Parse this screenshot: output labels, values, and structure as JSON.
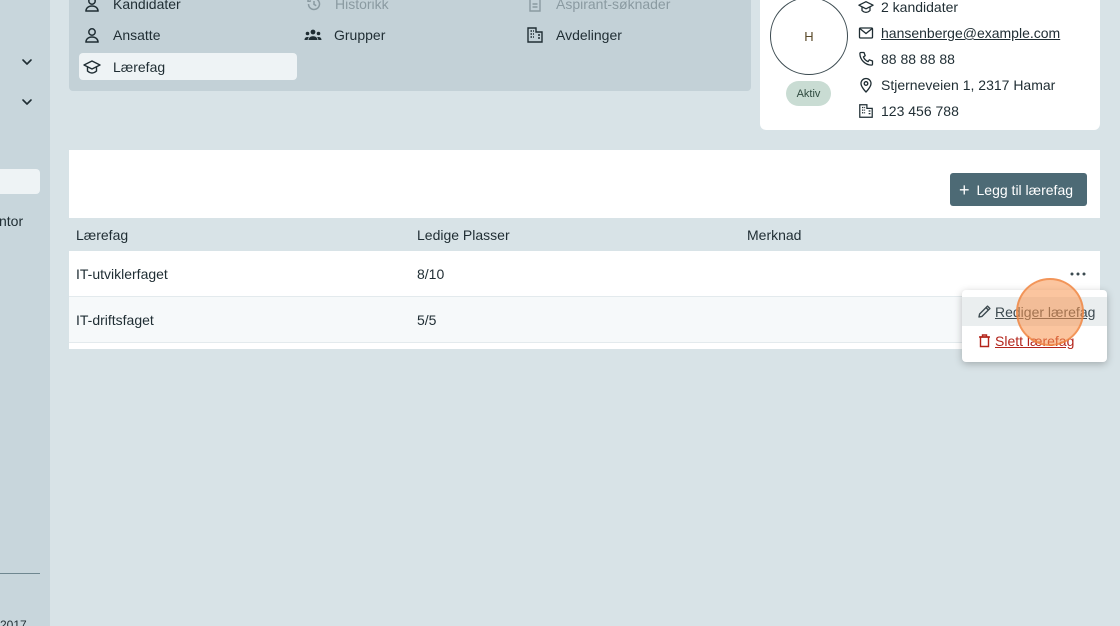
{
  "sidebar": {
    "partial_text": "ntor",
    "bottom_text": "2017"
  },
  "nav": {
    "items": [
      {
        "label": "Kandidater",
        "icon": "user-icon",
        "state": "normal"
      },
      {
        "label": "Historikk",
        "icon": "history-icon",
        "state": "disabled"
      },
      {
        "label": "Aspirant-søknader",
        "icon": "document-icon",
        "state": "disabled"
      },
      {
        "label": "Ansatte",
        "icon": "user-icon",
        "state": "normal"
      },
      {
        "label": "Grupper",
        "icon": "groups-icon",
        "state": "normal"
      },
      {
        "label": "Avdelinger",
        "icon": "building-icon",
        "state": "normal"
      },
      {
        "label": "Lærefag",
        "icon": "graduation-cap-icon",
        "state": "active"
      }
    ]
  },
  "profile": {
    "avatar_initial": "H",
    "status": "Aktiv",
    "candidates": "2 kandidater",
    "email": "hansenberge@example.com",
    "phone": "88 88 88 88",
    "address": "Stjerneveien 1, 2317 Hamar",
    "org_number": "123 456 788"
  },
  "table": {
    "add_button": "Legg til lærefag",
    "columns": [
      "Lærefag",
      "Ledige Plasser",
      "Merknad"
    ],
    "rows": [
      {
        "subject": "IT-utviklerfaget",
        "available": "8/10",
        "note": ""
      },
      {
        "subject": "IT-driftsfaget",
        "available": "5/5",
        "note": ""
      }
    ]
  },
  "menu": {
    "edit": "Rediger lærefag",
    "delete": "Slett lærefag"
  },
  "colors": {
    "primary_button": "#4d6a75",
    "delete_red": "#b3241b",
    "status_badge_bg": "#c9dcd3"
  }
}
